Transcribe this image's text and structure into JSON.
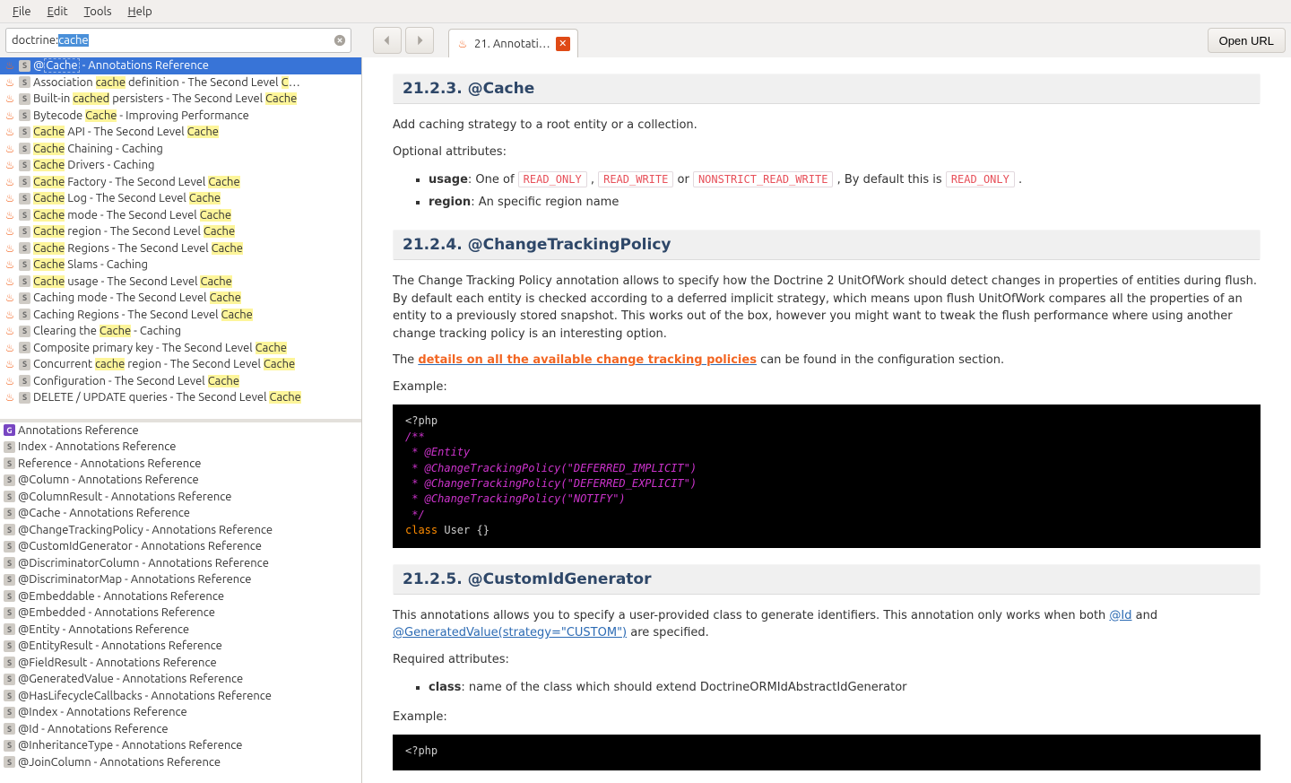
{
  "menu": {
    "file": "File",
    "edit": "Edit",
    "tools": "Tools",
    "help": "Help"
  },
  "search": {
    "prefix": "doctrine:",
    "selected": "cache"
  },
  "tab": {
    "label": "21. Annotati…"
  },
  "open_url": "Open URL",
  "topResults": [
    {
      "pre": "@",
      "hl": "Cache",
      "post": " - Annotations Reference",
      "sel": true
    },
    {
      "pre": "Association ",
      "hl": "cache",
      "post": " definition - The Second Level ",
      "hl2": "C",
      "post2": "…"
    },
    {
      "pre": "Built-in ",
      "hl": "cached",
      "post": " persisters - The Second Level ",
      "hl2": "Cache",
      "post2": ""
    },
    {
      "pre": "Bytecode ",
      "hl": "Cache",
      "post": " - Improving Performance"
    },
    {
      "pre": "",
      "hl": "Cache",
      "post": " API - The Second Level ",
      "hl2": "Cache",
      "post2": ""
    },
    {
      "pre": "",
      "hl": "Cache",
      "post": " Chaining - Caching"
    },
    {
      "pre": "",
      "hl": "Cache",
      "post": " Drivers - Caching"
    },
    {
      "pre": "",
      "hl": "Cache",
      "post": " Factory - The Second Level ",
      "hl2": "Cache",
      "post2": ""
    },
    {
      "pre": "",
      "hl": "Cache",
      "post": " Log - The Second Level ",
      "hl2": "Cache",
      "post2": ""
    },
    {
      "pre": "",
      "hl": "Cache",
      "post": " mode - The Second Level ",
      "hl2": "Cache",
      "post2": ""
    },
    {
      "pre": "",
      "hl": "Cache",
      "post": " region - The Second Level ",
      "hl2": "Cache",
      "post2": ""
    },
    {
      "pre": "",
      "hl": "Cache",
      "post": " Regions - The Second Level ",
      "hl2": "Cache",
      "post2": ""
    },
    {
      "pre": "",
      "hl": "Cache",
      "post": " Slams - Caching"
    },
    {
      "pre": "",
      "hl": "Cache",
      "post": " usage - The Second Level ",
      "hl2": "Cache",
      "post2": ""
    },
    {
      "pre": "Caching mode - The Second Level ",
      "hl": "Cache",
      "post": ""
    },
    {
      "pre": "Caching Regions - The Second Level ",
      "hl": "Cache",
      "post": ""
    },
    {
      "pre": "Clearing the ",
      "hl": "Cache",
      "post": " - Caching"
    },
    {
      "pre": "Composite primary key - The Second Level ",
      "hl": "Cache",
      "post": ""
    },
    {
      "pre": "Concurrent ",
      "hl": "cache",
      "post": " region - The Second Level ",
      "hl2": "Cache",
      "post2": ""
    },
    {
      "pre": "Configuration - The Second Level ",
      "hl": "Cache",
      "post": ""
    },
    {
      "pre": "DELETE / UPDATE queries - The Second Level ",
      "hl": "Cache",
      "post": ""
    }
  ],
  "bottomResults": [
    {
      "icon": "g",
      "text": "Annotations Reference"
    },
    {
      "icon": "s",
      "text": "Index - Annotations Reference"
    },
    {
      "icon": "s",
      "text": "Reference - Annotations Reference"
    },
    {
      "icon": "s",
      "text": "@Column - Annotations Reference"
    },
    {
      "icon": "s",
      "text": "@ColumnResult - Annotations Reference"
    },
    {
      "icon": "s",
      "text": "@Cache - Annotations Reference"
    },
    {
      "icon": "s",
      "text": "@ChangeTrackingPolicy - Annotations Reference"
    },
    {
      "icon": "s",
      "text": "@CustomIdGenerator - Annotations Reference"
    },
    {
      "icon": "s",
      "text": "@DiscriminatorColumn - Annotations Reference"
    },
    {
      "icon": "s",
      "text": "@DiscriminatorMap - Annotations Reference"
    },
    {
      "icon": "s",
      "text": "@Embeddable - Annotations Reference"
    },
    {
      "icon": "s",
      "text": "@Embedded - Annotations Reference"
    },
    {
      "icon": "s",
      "text": "@Entity - Annotations Reference"
    },
    {
      "icon": "s",
      "text": "@EntityResult - Annotations Reference"
    },
    {
      "icon": "s",
      "text": "@FieldResult - Annotations Reference"
    },
    {
      "icon": "s",
      "text": "@GeneratedValue - Annotations Reference"
    },
    {
      "icon": "s",
      "text": "@HasLifecycleCallbacks - Annotations Reference"
    },
    {
      "icon": "s",
      "text": "@Index - Annotations Reference"
    },
    {
      "icon": "s",
      "text": "@Id - Annotations Reference"
    },
    {
      "icon": "s",
      "text": "@InheritanceType - Annotations Reference"
    },
    {
      "icon": "s",
      "text": "@JoinColumn - Annotations Reference"
    }
  ],
  "content": {
    "h1": "21.2.3. @Cache",
    "p1": "Add caching strategy to a root entity or a collection.",
    "p2": "Optional attributes:",
    "li1_label": "usage",
    "li1_text1": ": One of ",
    "li1_c1": "READ_ONLY",
    "li1_text2": " , ",
    "li1_c2": "READ_WRITE",
    "li1_text3": " or ",
    "li1_c3": "NONSTRICT_READ_WRITE",
    "li1_text4": " , By default this is ",
    "li1_c4": "READ_ONLY",
    "li1_text5": " .",
    "li2_label": "region",
    "li2_text": ": An specific region name",
    "h2": "21.2.4. @ChangeTrackingPolicy",
    "p3": "The Change Tracking Policy annotation allows to specify how the Doctrine 2 UnitOfWork should detect changes in properties of entities during flush. By default each entity is checked according to a deferred implicit strategy, which means upon flush UnitOfWork compares all the properties of an entity to a previously stored snapshot. This works out of the box, however you might want to tweak the flush performance where using another change tracking policy is an interesting option.",
    "p4_pre": "The ",
    "p4_link": "details on all the available change tracking policies",
    "p4_post": " can be found in the configuration section.",
    "example": "Example:",
    "code": {
      "l1": "<?php",
      "l2": "/**",
      "l3": " * @Entity",
      "l4": " * @ChangeTrackingPolicy(\"DEFERRED_IMPLICIT\")",
      "l5": " * @ChangeTrackingPolicy(\"DEFERRED_EXPLICIT\")",
      "l6": " * @ChangeTrackingPolicy(\"NOTIFY\")",
      "l7": " */",
      "l8a": "class",
      "l8b": " User ",
      "l8c": "{}"
    },
    "h3": "21.2.5. @CustomIdGenerator",
    "p5_pre": "This annotations allows you to specify a user-provided class to generate identifiers. This annotation only works when both ",
    "p5_link1": "@Id",
    "p5_mid": " and ",
    "p5_link2": "@GeneratedValue(strategy=\"CUSTOM\")",
    "p5_post": " are specified.",
    "p6": "Required attributes:",
    "li3_label": "class",
    "li3_text": ": name of the class which should extend DoctrineORMIdAbstractIdGenerator",
    "code2_l1": "<?php"
  }
}
